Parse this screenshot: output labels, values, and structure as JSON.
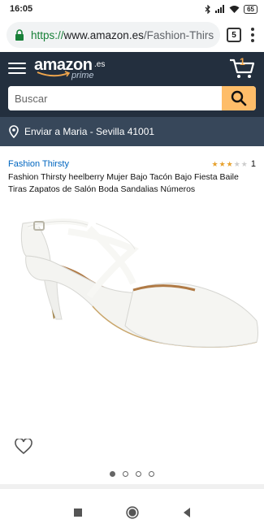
{
  "status_bar": {
    "time": "16:05",
    "battery": "65",
    "icons": [
      "bluetooth-icon",
      "signal-icon",
      "wifi-icon",
      "battery-icon"
    ]
  },
  "browser": {
    "url_scheme": "https://",
    "url_host": "www.amazon.es",
    "url_path": "/Fashion-Thirsty",
    "tab_count": "5"
  },
  "amazon": {
    "logo_word": "amazon",
    "logo_tld": ".es",
    "logo_prime": "prime",
    "cart_count": "1",
    "brand_colors": {
      "header": "#232f3e",
      "deliver": "#37475a",
      "search_button": "#febd69",
      "cart": "#f0a64d"
    }
  },
  "search": {
    "placeholder": "Buscar",
    "value": ""
  },
  "deliver": {
    "label": "Enviar a Maria - Sevilla 41001"
  },
  "product": {
    "brand": "Fashion Thirsty",
    "rating": 3,
    "rating_max": 5,
    "review_count": "1",
    "title": "Fashion Thirsty heelberry Mujer Bajo Tacón Bajo Fiesta Baile Tiras Zapatos de Salón Boda Sandalias Números",
    "image_page": 1,
    "image_pages": 4
  }
}
